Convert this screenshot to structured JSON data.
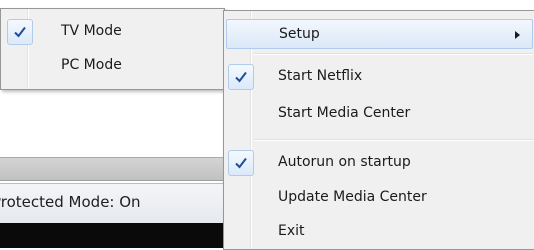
{
  "background": {
    "status_text": "Protected Mode: On"
  },
  "main_menu": {
    "items": [
      {
        "label": "Setup",
        "checked": false,
        "has_submenu": true,
        "highlighted": true
      },
      {
        "label": "Start Netflix",
        "checked": true
      },
      {
        "label": "Start Media Center",
        "checked": false
      },
      {
        "label": "Autorun on startup",
        "checked": true
      },
      {
        "label": "Update Media Center",
        "checked": false
      },
      {
        "label": "Exit",
        "checked": false
      }
    ]
  },
  "sub_menu": {
    "items": [
      {
        "label": "TV Mode",
        "checked": true
      },
      {
        "label": "PC Mode",
        "checked": false
      }
    ]
  },
  "colors": {
    "menu_bg": "#f0f0f0",
    "highlight": "#dbe8f8",
    "check_mark": "#1c4f9c"
  }
}
